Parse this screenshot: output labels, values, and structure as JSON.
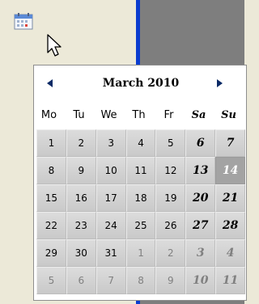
{
  "calendar": {
    "month_title": "March 2010",
    "weekdays": [
      {
        "label": "Mo",
        "weekend": false
      },
      {
        "label": "Tu",
        "weekend": false
      },
      {
        "label": "We",
        "weekend": false
      },
      {
        "label": "Th",
        "weekend": false
      },
      {
        "label": "Fr",
        "weekend": false
      },
      {
        "label": "Sa",
        "weekend": true
      },
      {
        "label": "Su",
        "weekend": true
      }
    ],
    "weeks": [
      [
        {
          "label": "1",
          "weekend": false,
          "other_month": false
        },
        {
          "label": "2",
          "weekend": false,
          "other_month": false
        },
        {
          "label": "3",
          "weekend": false,
          "other_month": false
        },
        {
          "label": "4",
          "weekend": false,
          "other_month": false
        },
        {
          "label": "5",
          "weekend": false,
          "other_month": false
        },
        {
          "label": "6",
          "weekend": true,
          "other_month": false
        },
        {
          "label": "7",
          "weekend": true,
          "other_month": false
        }
      ],
      [
        {
          "label": "8",
          "weekend": false,
          "other_month": false
        },
        {
          "label": "9",
          "weekend": false,
          "other_month": false
        },
        {
          "label": "10",
          "weekend": false,
          "other_month": false
        },
        {
          "label": "11",
          "weekend": false,
          "other_month": false
        },
        {
          "label": "12",
          "weekend": false,
          "other_month": false
        },
        {
          "label": "13",
          "weekend": true,
          "other_month": false
        },
        {
          "label": "14",
          "weekend": true,
          "other_month": false,
          "selected": true
        }
      ],
      [
        {
          "label": "15",
          "weekend": false,
          "other_month": false
        },
        {
          "label": "16",
          "weekend": false,
          "other_month": false
        },
        {
          "label": "17",
          "weekend": false,
          "other_month": false
        },
        {
          "label": "18",
          "weekend": false,
          "other_month": false
        },
        {
          "label": "19",
          "weekend": false,
          "other_month": false
        },
        {
          "label": "20",
          "weekend": true,
          "other_month": false
        },
        {
          "label": "21",
          "weekend": true,
          "other_month": false
        }
      ],
      [
        {
          "label": "22",
          "weekend": false,
          "other_month": false
        },
        {
          "label": "23",
          "weekend": false,
          "other_month": false
        },
        {
          "label": "24",
          "weekend": false,
          "other_month": false
        },
        {
          "label": "25",
          "weekend": false,
          "other_month": false
        },
        {
          "label": "26",
          "weekend": false,
          "other_month": false
        },
        {
          "label": "27",
          "weekend": true,
          "other_month": false
        },
        {
          "label": "28",
          "weekend": true,
          "other_month": false
        }
      ],
      [
        {
          "label": "29",
          "weekend": false,
          "other_month": false
        },
        {
          "label": "30",
          "weekend": false,
          "other_month": false
        },
        {
          "label": "31",
          "weekend": false,
          "other_month": false
        },
        {
          "label": "1",
          "weekend": false,
          "other_month": true
        },
        {
          "label": "2",
          "weekend": false,
          "other_month": true
        },
        {
          "label": "3",
          "weekend": true,
          "other_month": true
        },
        {
          "label": "4",
          "weekend": true,
          "other_month": true
        }
      ],
      [
        {
          "label": "5",
          "weekend": false,
          "other_month": true
        },
        {
          "label": "6",
          "weekend": false,
          "other_month": true
        },
        {
          "label": "7",
          "weekend": false,
          "other_month": true
        },
        {
          "label": "8",
          "weekend": false,
          "other_month": true
        },
        {
          "label": "9",
          "weekend": false,
          "other_month": true
        },
        {
          "label": "10",
          "weekend": true,
          "other_month": true
        },
        {
          "label": "11",
          "weekend": true,
          "other_month": true
        }
      ]
    ],
    "icons": {
      "open_button": "calendar-icon",
      "prev": "triangle-left-icon",
      "next": "triangle-right-icon",
      "pointer": "mouse-cursor-icon"
    },
    "colors": {
      "window_bg": "#ece9d8",
      "splitter": "#0a3ccf",
      "right_pane": "#7e7e7e",
      "selected_day_bg": "#a3a3a3"
    }
  }
}
